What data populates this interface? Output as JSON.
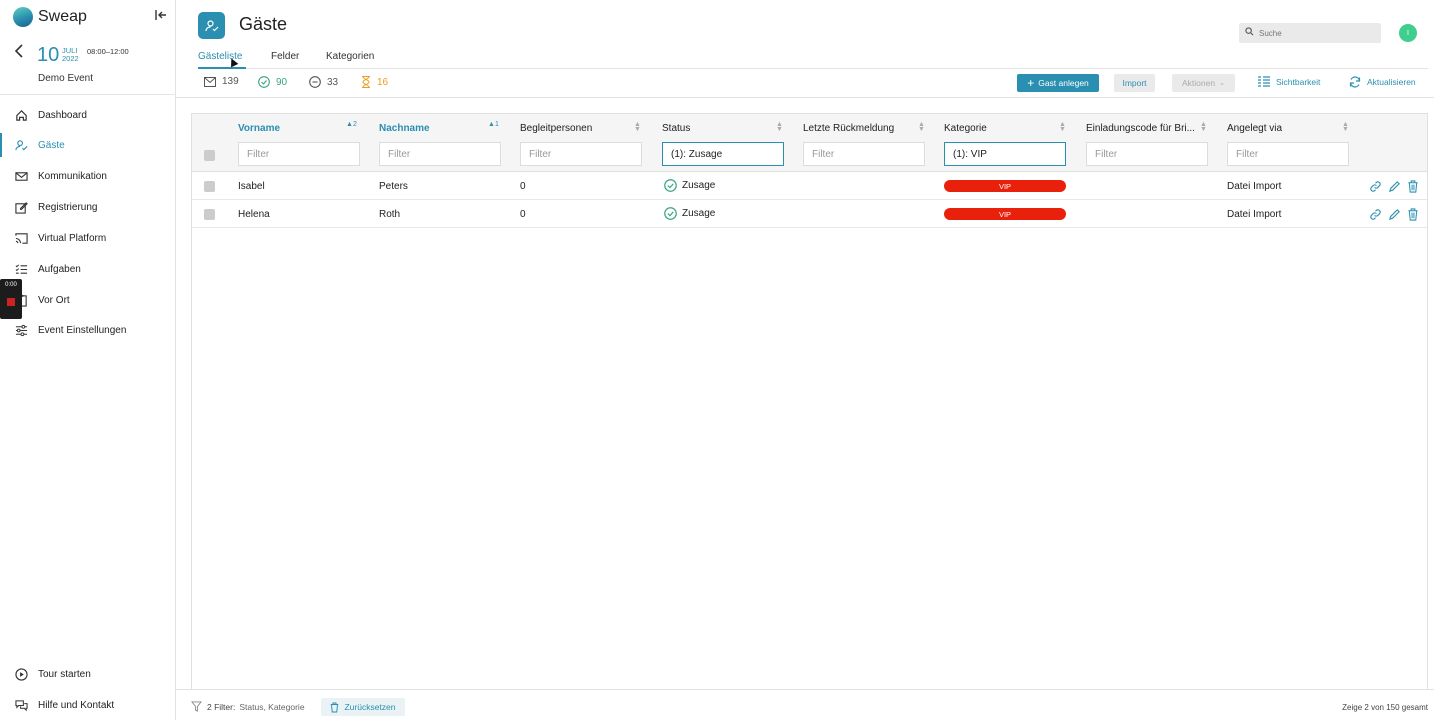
{
  "app": {
    "logo_text": "Sweap"
  },
  "event": {
    "day": "10",
    "month": "JULI",
    "year": "2022",
    "time": "08:00–12:00",
    "name": "Demo Event"
  },
  "sidebar": {
    "items": [
      {
        "label": "Dashboard",
        "icon": "home-icon"
      },
      {
        "label": "Gäste",
        "icon": "user-check-icon",
        "active": true
      },
      {
        "label": "Kommunikation",
        "icon": "mail-icon"
      },
      {
        "label": "Registrierung",
        "icon": "edit-icon"
      },
      {
        "label": "Virtual Platform",
        "icon": "cast-icon"
      },
      {
        "label": "Aufgaben",
        "icon": "list-check-icon"
      },
      {
        "label": "Vor Ort",
        "icon": "clipboard-icon"
      },
      {
        "label": "Event Einstellungen",
        "icon": "sliders-icon"
      }
    ],
    "bottom": [
      {
        "label": "Tour starten",
        "icon": "play-circle-icon"
      },
      {
        "label": "Hilfe und Kontakt",
        "icon": "chat-icon"
      }
    ],
    "recorder_time": "0:00"
  },
  "header": {
    "title": "Gäste",
    "search_placeholder": "Suche",
    "avatar_initial": "I",
    "tabs": [
      {
        "label": "Gästeliste",
        "active": true
      },
      {
        "label": "Felder"
      },
      {
        "label": "Kategorien"
      }
    ]
  },
  "stats": {
    "invited": "139",
    "accepted": "90",
    "declined": "33",
    "pending": "16"
  },
  "toolbar": {
    "add_guest": "Gast anlegen",
    "import": "Import",
    "actions": "Aktionen",
    "visibility": "Sichtbarkeit",
    "refresh": "Aktualisieren"
  },
  "grid": {
    "columns": [
      {
        "title": "Vorname",
        "sort": "2"
      },
      {
        "title": "Nachname",
        "sort": "1"
      },
      {
        "title": "Begleitpersonen"
      },
      {
        "title": "Status"
      },
      {
        "title": "Letzte Rückmeldung"
      },
      {
        "title": "Kategorie"
      },
      {
        "title": "Einladungscode für Bri..."
      },
      {
        "title": "Angelegt via"
      }
    ],
    "filter_placeholder": "Filter",
    "filters": {
      "status": "(1): Zusage",
      "kategorie": "(1): VIP"
    },
    "rows": [
      {
        "vorname": "Isabel",
        "nachname": "Peters",
        "begleitpersonen": "0",
        "status": "Zusage",
        "kategorie": "VIP",
        "angelegt_via": "Datei Import"
      },
      {
        "vorname": "Helena",
        "nachname": "Roth",
        "begleitpersonen": "0",
        "status": "Zusage",
        "kategorie": "VIP",
        "angelegt_via": "Datei Import"
      }
    ]
  },
  "footer": {
    "filter_count": "2 Filter:",
    "filter_names": "Status, Kategorie",
    "reset": "Zurücksetzen",
    "count_text": "Zeige 2 von 150 gesamt"
  },
  "colors": {
    "accent": "#2a8fb0",
    "vip": "#e8200c",
    "success": "#3aa57a",
    "pending": "#e8a020",
    "avatar": "#3ecf8e"
  }
}
